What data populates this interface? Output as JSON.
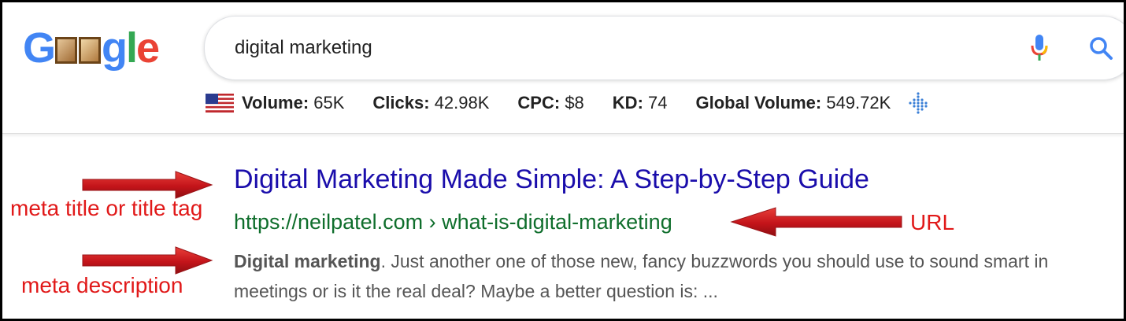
{
  "logo": {
    "text_g": "G",
    "text_rest": "gle"
  },
  "search": {
    "query": "digital marketing"
  },
  "metrics": {
    "volume_label": "Volume:",
    "volume_value": " 65K",
    "clicks_label": "Clicks:",
    "clicks_value": " 42.98K",
    "cpc_label": "CPC:",
    "cpc_value": " $8",
    "kd_label": "KD:",
    "kd_value": " 74",
    "global_label": "Global Volume:",
    "global_value": " 549.72K"
  },
  "result": {
    "title": "Digital Marketing Made Simple: A Step-by-Step Guide",
    "url": "https://neilpatel.com › what-is-digital-marketing",
    "desc_bold": "Digital marketing",
    "desc_rest": ". Just another one of those new, fancy buzzwords you should use to sound smart in meetings or is it the real deal? Maybe a better question is: ..."
  },
  "annotations": {
    "title_label": "meta title or title tag",
    "url_label": "URL",
    "description_label": "meta description"
  },
  "colors": {
    "link_blue": "#1a0dab",
    "url_green": "#0f6e2c",
    "annotation_red": "#e11919",
    "google_blue": "#4285f4",
    "google_red": "#ea4335",
    "google_yellow": "#fbbc05",
    "google_green": "#34a853"
  },
  "icons": [
    "mic-icon",
    "search-icon",
    "us-flag-icon",
    "dot-chart-icon",
    "arrow-icon"
  ]
}
